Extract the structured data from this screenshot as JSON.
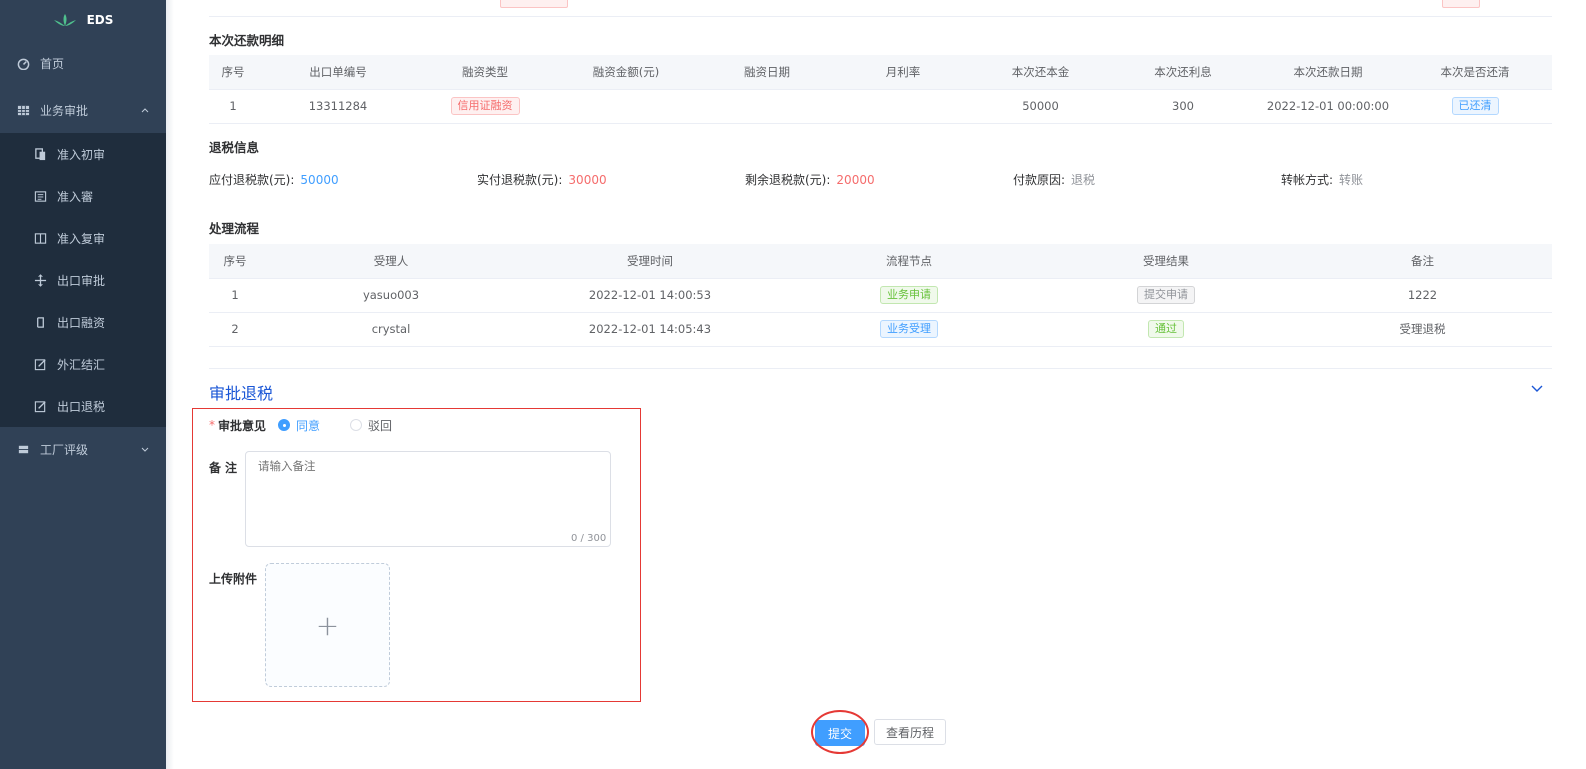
{
  "app": {
    "logo_text": "EDS"
  },
  "sidebar": {
    "items": [
      {
        "label": "首页",
        "icon": "dashboard-icon"
      },
      {
        "label": "业务审批",
        "icon": "table-icon",
        "expanded": true
      },
      {
        "label": "准入初审",
        "icon": "copy-icon"
      },
      {
        "label": "准入審",
        "icon": "list-icon"
      },
      {
        "label": "准入复审",
        "icon": "book-icon"
      },
      {
        "label": "出口审批",
        "icon": "move-icon"
      },
      {
        "label": "出口融资",
        "icon": "bracket-icon"
      },
      {
        "label": "外汇结汇",
        "icon": "edit-icon"
      },
      {
        "label": "出口退税",
        "icon": "edit-icon"
      },
      {
        "label": "工厂评级",
        "icon": "server-icon",
        "expanded": false
      }
    ]
  },
  "repayment": {
    "title": "本次还款明细",
    "columns": [
      "序号",
      "出口单编号",
      "融资类型",
      "融资金额(元)",
      "融资日期",
      "月利率",
      "本次还本金",
      "本次还利息",
      "本次还款日期",
      "本次是否还清"
    ],
    "rows": [
      {
        "no": "1",
        "order": "13311284",
        "type": "信用证融资",
        "amount": "",
        "date": "",
        "rate": "",
        "principal": "50000",
        "interest": "300",
        "repay_date": "2022-12-01 00:00:00",
        "cleared": "已还清"
      }
    ]
  },
  "refund": {
    "title": "退税信息",
    "payable_label": "应付退税款(元):",
    "payable_value": "50000",
    "paid_label": "实付退税款(元):",
    "paid_value": "30000",
    "remaining_label": "剩余退税款(元):",
    "remaining_value": "20000",
    "reason_label": "付款原因:",
    "reason_value": "退税",
    "method_label": "转帐方式:",
    "method_value": "转账",
    "colors": {
      "payable": "#409eff",
      "paid": "#f56c6c",
      "remaining": "#f56c6c",
      "plain": "#909399"
    }
  },
  "process": {
    "title": "处理流程",
    "columns": [
      "序号",
      "受理人",
      "受理时间",
      "流程节点",
      "受理结果",
      "备注"
    ],
    "rows": [
      {
        "no": "1",
        "handler": "yasuo003",
        "time": "2022-12-01 14:00:53",
        "node": "业务申请",
        "node_tag": "success",
        "result": "提交申请",
        "result_tag": "info",
        "note": "1222"
      },
      {
        "no": "2",
        "handler": "crystal",
        "time": "2022-12-01 14:05:43",
        "node": "业务受理",
        "node_tag": "primary",
        "result": "通过",
        "result_tag": "success",
        "note": "受理退税"
      }
    ]
  },
  "approval": {
    "title": "审批退税",
    "opinion_label": "审批意见",
    "option_agree": "同意",
    "option_reject": "驳回",
    "selected": "agree",
    "remark_label": "备注",
    "remark_placeholder": "请输入备注",
    "remark_counter": "0 / 300",
    "upload_label": "上传附件",
    "upload_plus": "+"
  },
  "actions": {
    "submit": "提交",
    "history": "查看历程"
  }
}
